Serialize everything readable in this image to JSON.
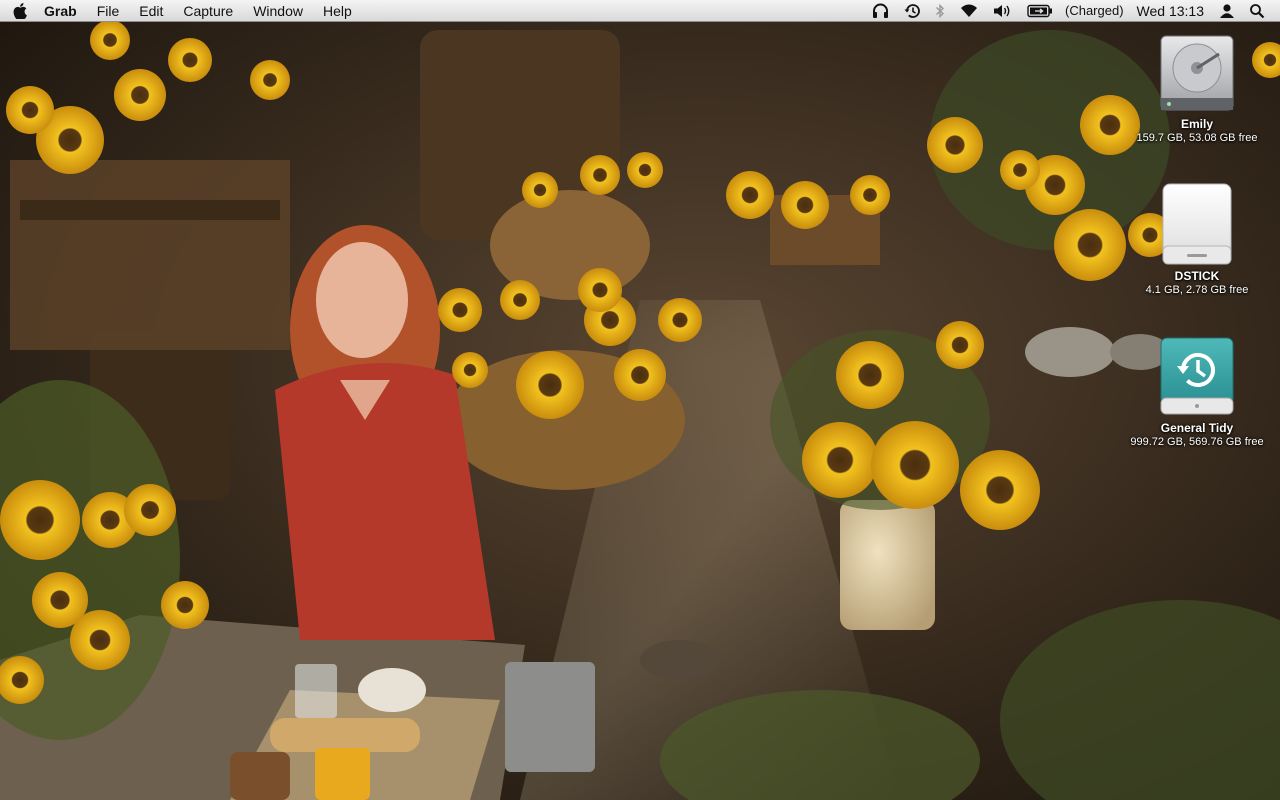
{
  "menubar": {
    "app_name": "Grab",
    "menus": [
      "File",
      "Edit",
      "Capture",
      "Window",
      "Help"
    ],
    "status_items": [
      "headphones-icon",
      "time-machine-icon",
      "bluetooth-icon",
      "wifi-icon",
      "volume-icon",
      "battery-icon"
    ],
    "battery_status": "(Charged)",
    "clock": "Wed 13:13",
    "user_icon": "user-icon",
    "search_icon": "spotlight-search-icon"
  },
  "desktop": {
    "icons": [
      {
        "name": "Emily",
        "info": "159.7 GB, 53.08 GB free",
        "kind": "internal-hard-drive-icon"
      },
      {
        "name": "DSTICK",
        "info": "4.1 GB, 2.78 GB free",
        "kind": "external-drive-icon"
      },
      {
        "name": "General Tidy",
        "info": "999.72 GB, 569.76 GB free",
        "kind": "time-machine-drive-icon"
      }
    ]
  },
  "wallpaper": {
    "description_colors": {
      "ground": "#3a2c1d",
      "sunflower": "#e8b417",
      "sunflower_center": "#5a3a12",
      "dress": "#b5392b",
      "hair": "#b5552a"
    }
  }
}
